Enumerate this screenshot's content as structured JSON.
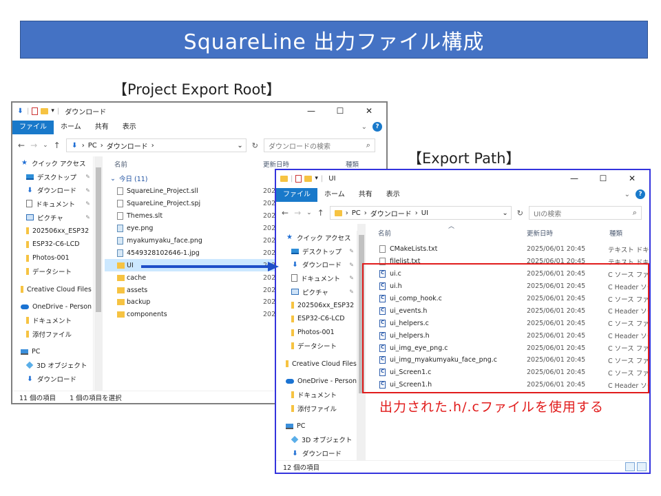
{
  "title": "SquareLine 出力ファイル構成",
  "captions": {
    "root": "【Project Export Root】",
    "export": "【Export Path】"
  },
  "window1": {
    "title": "ダウンロード",
    "ribbon": [
      "ファイル",
      "ホーム",
      "共有",
      "表示"
    ],
    "breadcrumb": [
      "PC",
      "ダウンロード"
    ],
    "search_placeholder": "ダウンロードの検索",
    "columns": [
      "名前",
      "更新日時",
      "種類"
    ],
    "group_label": "今日 (11)",
    "nav_items": [
      {
        "label": "クイック アクセス",
        "icon": "star-icon",
        "pinned": false
      },
      {
        "label": "デスクトップ",
        "icon": "desktop-icon",
        "pinned": true
      },
      {
        "label": "ダウンロード",
        "icon": "download-icon",
        "pinned": true
      },
      {
        "label": "ドキュメント",
        "icon": "document-icon",
        "pinned": true
      },
      {
        "label": "ピクチャ",
        "icon": "pictures-icon",
        "pinned": true
      },
      {
        "label": "202506xx_ESP32",
        "icon": "folder-icon",
        "pinned": false
      },
      {
        "label": "ESP32-C6-LCD",
        "icon": "folder-icon",
        "pinned": false
      },
      {
        "label": "Photos-001",
        "icon": "folder-icon",
        "pinned": false
      },
      {
        "label": "データシート",
        "icon": "folder-icon",
        "pinned": false
      },
      {
        "label": "Creative Cloud Files",
        "icon": "folder-icon",
        "pinned": false
      },
      {
        "label": "OneDrive - Person",
        "icon": "cloud-icon",
        "pinned": false
      },
      {
        "label": "ドキュメント",
        "icon": "folder-icon",
        "pinned": false
      },
      {
        "label": "添付ファイル",
        "icon": "folder-icon",
        "pinned": false
      },
      {
        "label": "PC",
        "icon": "pc-icon",
        "pinned": false
      },
      {
        "label": "3D オブジェクト",
        "icon": "3d-objects-icon",
        "pinned": false
      },
      {
        "label": "ダウンロード",
        "icon": "download-icon",
        "pinned": false
      }
    ],
    "files": [
      {
        "name": "SquareLine_Project.sll",
        "date": "202",
        "icon": "file"
      },
      {
        "name": "SquareLine_Project.spj",
        "date": "202",
        "icon": "file"
      },
      {
        "name": "Themes.slt",
        "date": "202",
        "icon": "file"
      },
      {
        "name": "eye.png",
        "date": "202",
        "icon": "image"
      },
      {
        "name": "myakumyaku_face.png",
        "date": "202",
        "icon": "image"
      },
      {
        "name": "4549328102646-1.jpg",
        "date": "202",
        "icon": "image"
      },
      {
        "name": "UI",
        "date": "202",
        "icon": "folder",
        "selected": true
      },
      {
        "name": "cache",
        "date": "202",
        "icon": "folder"
      },
      {
        "name": "assets",
        "date": "202",
        "icon": "folder"
      },
      {
        "name": "backup",
        "date": "202",
        "icon": "folder"
      },
      {
        "name": "components",
        "date": "202",
        "icon": "folder"
      }
    ],
    "status_count": "11 個の項目",
    "status_selected": "1 個の項目を選択"
  },
  "window2": {
    "title": "UI",
    "ribbon": [
      "ファイル",
      "ホーム",
      "共有",
      "表示"
    ],
    "breadcrumb": [
      "PC",
      "ダウンロード",
      "UI"
    ],
    "search_placeholder": "UIの検索",
    "columns": [
      "名前",
      "更新日時",
      "種類"
    ],
    "nav_items": [
      {
        "label": "クイック アクセス",
        "icon": "star-icon",
        "pinned": false
      },
      {
        "label": "デスクトップ",
        "icon": "desktop-icon",
        "pinned": true
      },
      {
        "label": "ダウンロード",
        "icon": "download-icon",
        "pinned": true
      },
      {
        "label": "ドキュメント",
        "icon": "document-icon",
        "pinned": true
      },
      {
        "label": "ピクチャ",
        "icon": "pictures-icon",
        "pinned": true
      },
      {
        "label": "202506xx_ESP32",
        "icon": "folder-icon",
        "pinned": false
      },
      {
        "label": "ESP32-C6-LCD",
        "icon": "folder-icon",
        "pinned": false
      },
      {
        "label": "Photos-001",
        "icon": "folder-icon",
        "pinned": false
      },
      {
        "label": "データシート",
        "icon": "folder-icon",
        "pinned": false
      },
      {
        "label": "Creative Cloud Files",
        "icon": "folder-icon",
        "pinned": false
      },
      {
        "label": "OneDrive - Person",
        "icon": "cloud-icon",
        "pinned": false
      },
      {
        "label": "ドキュメント",
        "icon": "folder-icon",
        "pinned": false
      },
      {
        "label": "添付ファイル",
        "icon": "folder-icon",
        "pinned": false
      },
      {
        "label": "PC",
        "icon": "pc-icon",
        "pinned": false
      },
      {
        "label": "3D オブジェクト",
        "icon": "3d-objects-icon",
        "pinned": false
      },
      {
        "label": "ダウンロード",
        "icon": "download-icon",
        "pinned": false
      }
    ],
    "files": [
      {
        "name": "CMakeLists.txt",
        "date": "2025/06/01 20:45",
        "type": "テキスト ドキュメ",
        "icon": "file"
      },
      {
        "name": "filelist.txt",
        "date": "2025/06/01 20:45",
        "type": "テキスト ドキュメ",
        "icon": "file"
      },
      {
        "name": "ui.c",
        "date": "2025/06/01 20:45",
        "type": "C ソース ファイル",
        "icon": "c"
      },
      {
        "name": "ui.h",
        "date": "2025/06/01 20:45",
        "type": "C Header ソー",
        "icon": "c"
      },
      {
        "name": "ui_comp_hook.c",
        "date": "2025/06/01 20:45",
        "type": "C ソース ファイル",
        "icon": "c"
      },
      {
        "name": "ui_events.h",
        "date": "2025/06/01 20:45",
        "type": "C Header ソー",
        "icon": "c"
      },
      {
        "name": "ui_helpers.c",
        "date": "2025/06/01 20:45",
        "type": "C ソース ファイル",
        "icon": "c"
      },
      {
        "name": "ui_helpers.h",
        "date": "2025/06/01 20:45",
        "type": "C Header ソー",
        "icon": "c"
      },
      {
        "name": "ui_img_eye_png.c",
        "date": "2025/06/01 20:45",
        "type": "C ソース ファイル",
        "icon": "c"
      },
      {
        "name": "ui_img_myakumyaku_face_png.c",
        "date": "2025/06/01 20:45",
        "type": "C ソース ファイル",
        "icon": "c"
      },
      {
        "name": "ui_Screen1.c",
        "date": "2025/06/01 20:45",
        "type": "C ソース ファイル",
        "icon": "c"
      },
      {
        "name": "ui_Screen1.h",
        "date": "2025/06/01 20:45",
        "type": "C Header ソー",
        "icon": "c"
      }
    ],
    "status_count": "12 個の項目"
  },
  "note": "出力された.h/.cファイルを使用する",
  "colors": {
    "banner": "#4472c4",
    "highlight": "#e11b1b",
    "window2_border": "#3333dd",
    "arrow": "#1f4fc8",
    "file_tab": "#1979ca"
  }
}
